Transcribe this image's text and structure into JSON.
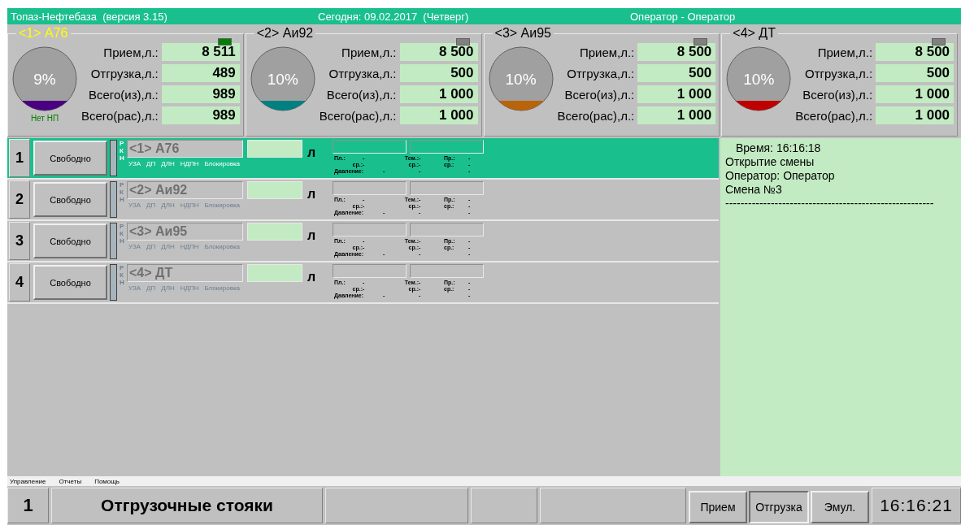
{
  "title_bar": {
    "app": "Топаз-Нефтебаза  (версия 3.15)",
    "date": "Сегодня: 09.02.2017  (Четверг)",
    "operator": "Оператор - Оператор"
  },
  "tanks": [
    {
      "name": "<1> А76",
      "selected": true,
      "indicator_on": true,
      "percent": "9%",
      "color": "#4b0082",
      "status": "Нет НП",
      "fields": [
        {
          "label": "Прием,л.:",
          "value": "8 511"
        },
        {
          "label": "Отгрузка,л.:",
          "value": "489"
        },
        {
          "label": "Всего(из),л.:",
          "value": "989"
        },
        {
          "label": "Всего(рас),л.:",
          "value": "989"
        }
      ]
    },
    {
      "name": "<2> Аи92",
      "selected": false,
      "indicator_on": false,
      "percent": "10%",
      "color": "#008080",
      "fields": [
        {
          "label": "Прием,л.:",
          "value": "8 500"
        },
        {
          "label": "Отгрузка,л.:",
          "value": "500"
        },
        {
          "label": "Всего(из),л.:",
          "value": "1 000"
        },
        {
          "label": "Всего(рас),л.:",
          "value": "1 000"
        }
      ]
    },
    {
      "name": "<3> Аи95",
      "selected": false,
      "indicator_on": false,
      "percent": "10%",
      "color": "#b8640a",
      "fields": [
        {
          "label": "Прием,л.:",
          "value": "8 500"
        },
        {
          "label": "Отгрузка,л.:",
          "value": "500"
        },
        {
          "label": "Всего(из),л.:",
          "value": "1 000"
        },
        {
          "label": "Всего(рас),л.:",
          "value": "1 000"
        }
      ]
    },
    {
      "name": "<4> ДТ",
      "selected": false,
      "indicator_on": false,
      "percent": "10%",
      "color": "#c00000",
      "fields": [
        {
          "label": "Прием,л.:",
          "value": "8 500"
        },
        {
          "label": "Отгрузка,л.:",
          "value": "500"
        },
        {
          "label": "Всего(из),л.:",
          "value": "1 000"
        },
        {
          "label": "Всего(рас),л.:",
          "value": "1 000"
        }
      ]
    }
  ],
  "stations": [
    {
      "number": "1",
      "selected": true,
      "status": "Свободно",
      "letters": [
        "Р",
        "К",
        "Н"
      ],
      "product": "<1> А76",
      "flags": [
        "УЗА",
        "ДП",
        "ДЛН",
        "НДПН",
        "Блокировка"
      ],
      "unit": "л",
      "readings": [
        [
          "Пл.:",
          "-",
          "Тем.:",
          "-",
          "Пр.:",
          "-"
        ],
        [
          "ср.:",
          "-",
          "ср.:",
          "-",
          "ср.:",
          "-"
        ],
        [
          "Давление:",
          "-",
          "-",
          "-"
        ]
      ]
    },
    {
      "number": "2",
      "selected": false,
      "status": "Свободно",
      "letters": [
        "Р",
        "К",
        "Н"
      ],
      "product": "<2> Аи92",
      "flags": [
        "УЗА",
        "ДП",
        "ДЛН",
        "НДПН",
        "Блокировка"
      ],
      "unit": "л",
      "readings": [
        [
          "Пл.:",
          "-",
          "Тем.:",
          "-",
          "Пр.:",
          "-"
        ],
        [
          "ср.:",
          "-",
          "ср.:",
          "-",
          "ср.:",
          "-"
        ],
        [
          "Давление:",
          "-",
          "-",
          "-"
        ]
      ]
    },
    {
      "number": "3",
      "selected": false,
      "status": "Свободно",
      "letters": [
        "Р",
        "К",
        "Н"
      ],
      "product": "<3> Аи95",
      "flags": [
        "УЗА",
        "ДП",
        "ДЛН",
        "НДПН",
        "Блокировка"
      ],
      "unit": "л",
      "readings": [
        [
          "Пл.:",
          "-",
          "Тем.:",
          "-",
          "Пр.:",
          "-"
        ],
        [
          "ср.:",
          "-",
          "ср.:",
          "-",
          "ср.:",
          "-"
        ],
        [
          "Давление:",
          "-",
          "-",
          "-"
        ]
      ]
    },
    {
      "number": "4",
      "selected": false,
      "status": "Свободно",
      "letters": [
        "Р",
        "К",
        "Н"
      ],
      "product": "<4> ДТ",
      "flags": [
        "УЗА",
        "ДП",
        "ДЛН",
        "НДПН",
        "Блокировка"
      ],
      "unit": "л",
      "readings": [
        [
          "Пл.:",
          "-",
          "Тем.:",
          "-",
          "Пр.:",
          "-"
        ],
        [
          "ср.:",
          "-",
          "ср.:",
          "-",
          "ср.:",
          "-"
        ],
        [
          "Давление:",
          "-",
          "-",
          "-"
        ]
      ]
    }
  ],
  "log": [
    {
      "text": "Время: 16:16:18",
      "indent": true
    },
    {
      "text": "Открытие смены",
      "indent": false
    },
    {
      "text": "Оператор: Оператор",
      "indent": false
    },
    {
      "text": "Смена №3",
      "indent": false
    },
    {
      "text": "-------------------------------------------------------",
      "indent": false
    }
  ],
  "menu": [
    "Управление",
    "Отчеты",
    "Помощь"
  ],
  "status_bar": {
    "number": "1",
    "title": "Отгрузочные стояки",
    "modes": [
      {
        "label": "Прием",
        "selected": false
      },
      {
        "label": "Отгрузка",
        "selected": true
      },
      {
        "label": "Эмул.",
        "selected": false
      }
    ],
    "clock": "16:16:21"
  }
}
